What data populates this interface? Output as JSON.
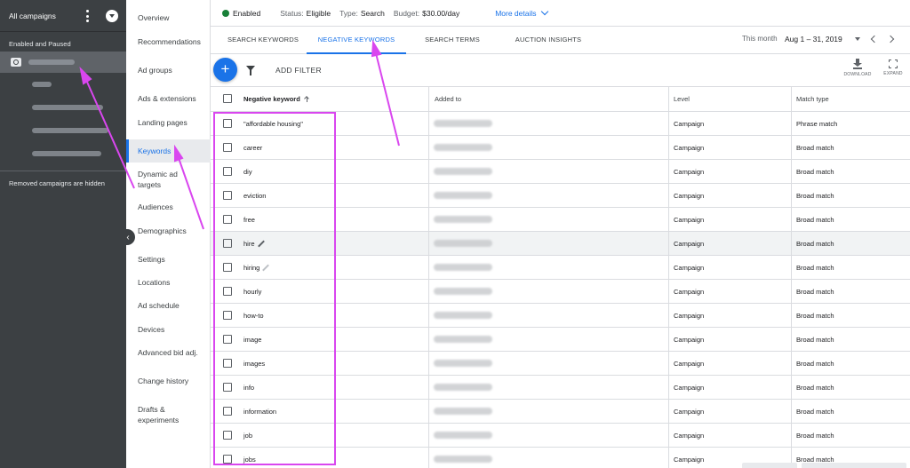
{
  "left_panel": {
    "title": "All campaigns",
    "section": "Enabled and Paused",
    "removed_note": "Removed campaigns are hidden"
  },
  "nav": {
    "items": [
      {
        "label": "Overview"
      },
      {
        "label": "Recommendations"
      },
      {
        "label": "Ad groups"
      },
      {
        "label": "Ads & extensions"
      },
      {
        "label": "Landing pages"
      },
      {
        "label": "Keywords"
      },
      {
        "label": "Dynamic ad targets"
      },
      {
        "label": "Audiences"
      },
      {
        "label": "Demographics"
      },
      {
        "label": "Settings"
      },
      {
        "label": "Locations"
      },
      {
        "label": "Ad schedule"
      },
      {
        "label": "Devices"
      },
      {
        "label": "Advanced bid adj."
      },
      {
        "label": "Change history"
      },
      {
        "label": "Drafts & experiments"
      }
    ]
  },
  "status_bar": {
    "status": "Enabled",
    "status_label": "Status:",
    "status_value": "Eligible",
    "type_label": "Type:",
    "type_value": "Search",
    "budget_label": "Budget:",
    "budget_value": "$30.00/day",
    "more_details": "More details"
  },
  "tabs": [
    {
      "label": "SEARCH KEYWORDS"
    },
    {
      "label": "NEGATIVE KEYWORDS"
    },
    {
      "label": "SEARCH TERMS"
    },
    {
      "label": "AUCTION INSIGHTS"
    }
  ],
  "date": {
    "label": "This month",
    "value": "Aug 1 – 31, 2019"
  },
  "toolbar": {
    "add_filter": "ADD FILTER",
    "download": "DOWNLOAD",
    "expand": "EXPAND"
  },
  "table": {
    "headers": {
      "keyword": "Negative keyword",
      "added_to": "Added to",
      "level": "Level",
      "match_type": "Match type"
    },
    "rows": [
      {
        "keyword": "\"affordable housing\"",
        "level": "Campaign",
        "match_type": "Phrase match"
      },
      {
        "keyword": "career",
        "level": "Campaign",
        "match_type": "Broad match"
      },
      {
        "keyword": "diy",
        "level": "Campaign",
        "match_type": "Broad match"
      },
      {
        "keyword": "eviction",
        "level": "Campaign",
        "match_type": "Broad match"
      },
      {
        "keyword": "free",
        "level": "Campaign",
        "match_type": "Broad match"
      },
      {
        "keyword": "hire",
        "level": "Campaign",
        "match_type": "Broad match"
      },
      {
        "keyword": "hiring",
        "level": "Campaign",
        "match_type": "Broad match"
      },
      {
        "keyword": "hourly",
        "level": "Campaign",
        "match_type": "Broad match"
      },
      {
        "keyword": "how-to",
        "level": "Campaign",
        "match_type": "Broad match"
      },
      {
        "keyword": "image",
        "level": "Campaign",
        "match_type": "Broad match"
      },
      {
        "keyword": "images",
        "level": "Campaign",
        "match_type": "Broad match"
      },
      {
        "keyword": "info",
        "level": "Campaign",
        "match_type": "Broad match"
      },
      {
        "keyword": "information",
        "level": "Campaign",
        "match_type": "Broad match"
      },
      {
        "keyword": "job",
        "level": "Campaign",
        "match_type": "Broad match"
      },
      {
        "keyword": "jobs",
        "level": "Campaign",
        "match_type": "Broad match"
      }
    ]
  },
  "colors": {
    "accent": "#1a73e8",
    "annotation": "#d946ef",
    "status_green": "#188038",
    "sidebar_dark": "#3c4043"
  }
}
